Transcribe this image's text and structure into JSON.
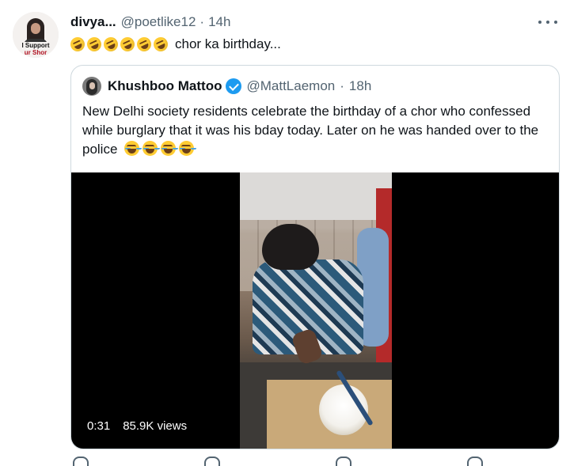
{
  "tweet": {
    "display_name": "divya...",
    "handle": "@poetlike12",
    "separator": "·",
    "time": "14h",
    "text": "chor ka birthday...",
    "emoji_count": 6,
    "emoji_icon": "rolling-on-floor-laughing-emoji",
    "avatar_text_line1": "I Support",
    "avatar_text_line2": "ur Shor"
  },
  "quoted_tweet": {
    "display_name": "Khushboo Mattoo",
    "handle": "@MattLaemon",
    "separator": "·",
    "time": "18h",
    "text": "New Delhi society residents celebrate the birthday of a chor who confessed while burglary that it was his bday today. Later on he was handed over to the police",
    "laugh_emoji_count": 4,
    "laugh_icon": "face-with-tears-of-joy-emoji",
    "verified_icon": "verified-badge-icon"
  },
  "video": {
    "duration": "0:31",
    "views": "85.9K views"
  },
  "colors": {
    "text_primary": "#0f1419",
    "text_secondary": "#536471",
    "verified_blue": "#1d9bf0",
    "border": "#cfd9de",
    "video_bg": "#000000"
  }
}
